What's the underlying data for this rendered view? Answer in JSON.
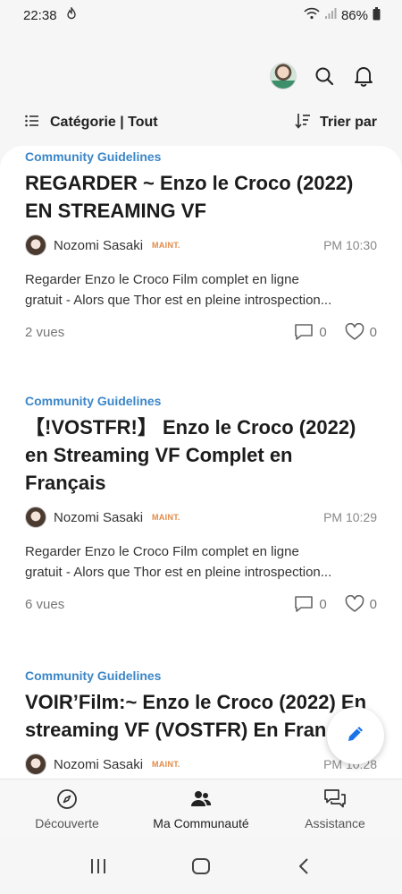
{
  "status": {
    "time": "22:38",
    "battery": "86%"
  },
  "filter": {
    "category_label": "Catégorie | Tout",
    "sort_label": "Trier par"
  },
  "posts": [
    {
      "category": "Community Guidelines",
      "title": "REGARDER ~ Enzo le Croco (2022) EN STREAMING VF",
      "author": "Nozomi Sasaki",
      "badge": "MAINT.",
      "time": "PM 10:30",
      "excerpt_line1": "Regarder Enzo le Croco Film complet en ligne",
      "excerpt_line2": "gratuit - Alors que Thor est en pleine introspection...",
      "views": "2 vues",
      "comments": "0",
      "likes": "0"
    },
    {
      "category": "Community Guidelines",
      "title": "【!VOSTFR!】 Enzo le Croco (2022) en Streaming VF Complet en Français",
      "author": "Nozomi Sasaki",
      "badge": "MAINT.",
      "time": "PM 10:29",
      "excerpt_line1": "Regarder Enzo le Croco Film complet en ligne",
      "excerpt_line2": "gratuit - Alors que Thor est en pleine introspection...",
      "views": "6 vues",
      "comments": "0",
      "likes": "0"
    },
    {
      "category": "Community Guidelines",
      "title": "VOIR’Film:~ Enzo le Croco (2022) En streaming VF (VOSTFR) En Fran",
      "author": "Nozomi Sasaki",
      "badge": "MAINT.",
      "time": "PM 10:28"
    }
  ],
  "bottom_nav": {
    "discover": "Découverte",
    "community": "Ma Communauté",
    "support": "Assistance"
  },
  "icons": {
    "status_app": "flame-icon",
    "wifi": "wifi-icon",
    "signal": "signal-icon",
    "battery": "battery-icon",
    "profile": "avatar",
    "search": "search-icon",
    "notifications": "bell-icon",
    "list": "list-icon",
    "sort": "sort-icon",
    "comment": "comment-icon",
    "like": "heart-icon",
    "write": "pencil-icon",
    "discover": "compass-icon",
    "community": "people-icon",
    "support": "chat-bubbles-icon"
  },
  "colors": {
    "accent": "#3b86c8",
    "badge": "#e28a4a",
    "fab_icon": "#1a73e8"
  }
}
